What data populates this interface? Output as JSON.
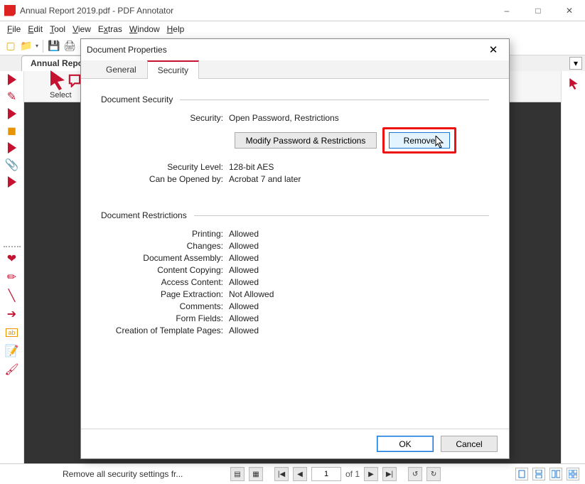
{
  "window": {
    "title": "Annual Report 2019.pdf - PDF Annotator"
  },
  "menubar": [
    "File",
    "Edit",
    "Tool",
    "View",
    "Extras",
    "Window",
    "Help"
  ],
  "document_tab": "Annual Report",
  "select_group": {
    "label": "Select"
  },
  "dialog": {
    "title": "Document Properties",
    "tabs": {
      "general": "General",
      "security": "Security"
    },
    "security_section": "Document Security",
    "security_label": "Security:",
    "security_value": "Open Password, Restrictions",
    "modify_btn": "Modify Password & Restrictions",
    "remove_btn": "Remove",
    "level_label": "Security Level:",
    "level_value": "128-bit AES",
    "opened_label": "Can be Opened by:",
    "opened_value": "Acrobat 7 and later",
    "restrictions_section": "Document Restrictions",
    "rows": {
      "printing_k": "Printing:",
      "printing_v": "Allowed",
      "changes_k": "Changes:",
      "changes_v": "Allowed",
      "assembly_k": "Document Assembly:",
      "assembly_v": "Allowed",
      "copy_k": "Content Copying:",
      "copy_v": "Allowed",
      "access_k": "Access Content:",
      "access_v": "Allowed",
      "extract_k": "Page Extraction:",
      "extract_v": "Not Allowed",
      "comments_k": "Comments:",
      "comments_v": "Allowed",
      "forms_k": "Form Fields:",
      "forms_v": "Allowed",
      "template_k": "Creation of Template Pages:",
      "template_v": "Allowed"
    },
    "ok": "OK",
    "cancel": "Cancel"
  },
  "statusbar": {
    "message": "Remove all security settings fr...",
    "page_field": "1",
    "page_total": "of 1"
  }
}
